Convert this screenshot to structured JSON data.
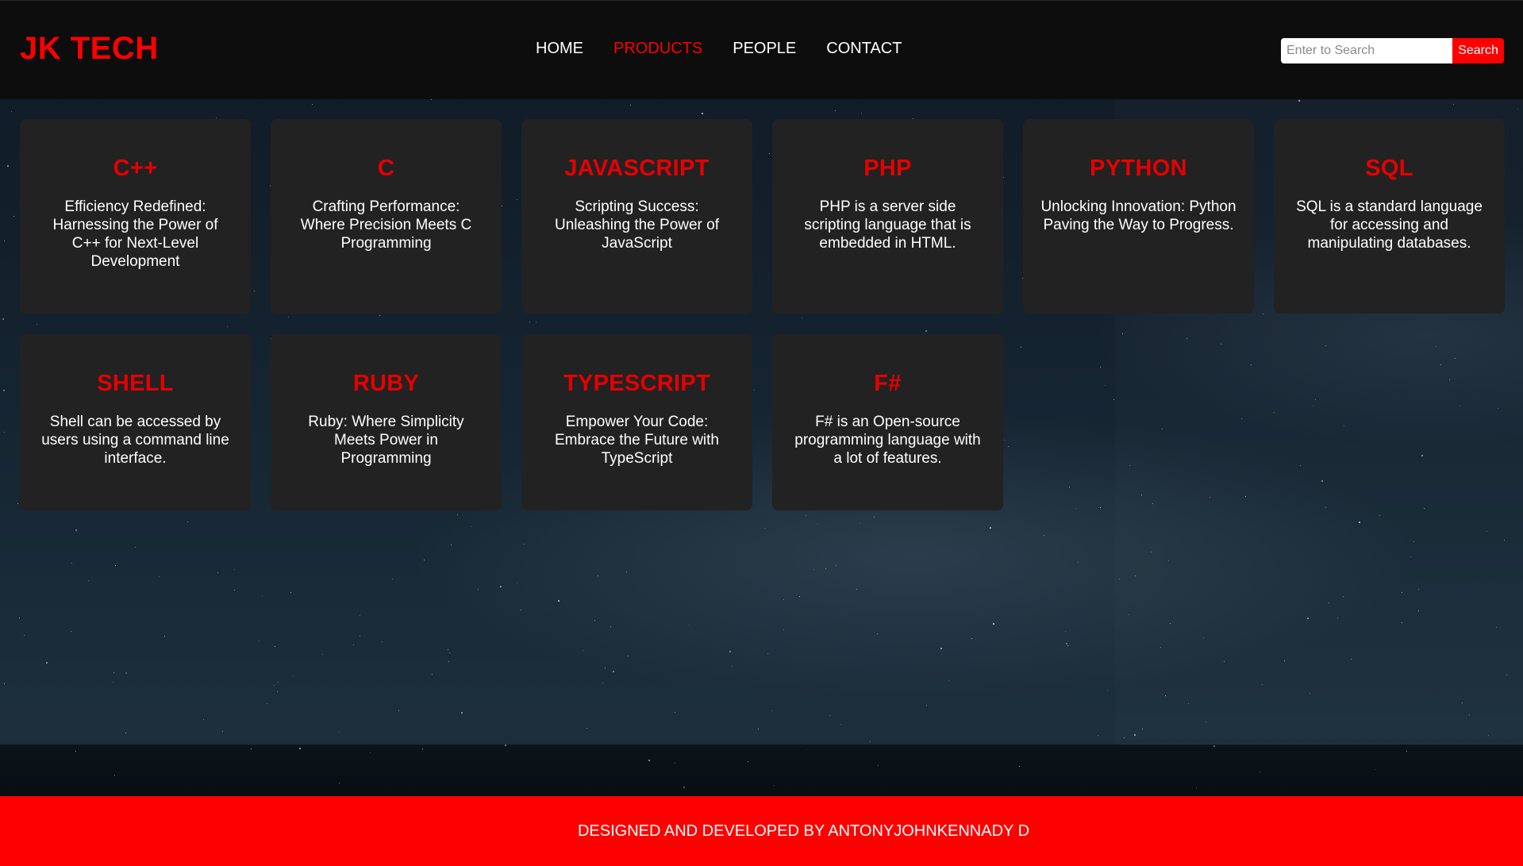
{
  "header": {
    "logo": "JK TECH",
    "nav": [
      {
        "label": "HOME",
        "active": false
      },
      {
        "label": "PRODUCTS",
        "active": true
      },
      {
        "label": "PEOPLE",
        "active": false
      },
      {
        "label": "CONTACT",
        "active": false
      }
    ],
    "search": {
      "placeholder": "Enter to Search",
      "value": "",
      "button_label": "Search"
    }
  },
  "products": [
    {
      "title": "C++",
      "description": "Efficiency Redefined: Harnessing the Power of C++ for Next-Level Development"
    },
    {
      "title": "C",
      "description": "Crafting Performance: Where Precision Meets C Programming"
    },
    {
      "title": "JAVASCRIPT",
      "description": "Scripting Success: Unleashing the Power of JavaScript"
    },
    {
      "title": "PHP",
      "description": "PHP is a server side scripting language that is embedded in HTML."
    },
    {
      "title": "PYTHON",
      "description": "Unlocking Innovation: Python Paving the Way to Progress."
    },
    {
      "title": "SQL",
      "description": "SQL is a standard language for accessing and manipulating databases."
    },
    {
      "title": "SHELL",
      "description": "Shell can be accessed by users using a command line interface."
    },
    {
      "title": "RUBY",
      "description": "Ruby: Where Simplicity Meets Power in Programming"
    },
    {
      "title": "TYPESCRIPT",
      "description": "Empower Your Code: Embrace the Future with TypeScript"
    },
    {
      "title": "F#",
      "description": "F# is an Open-source programming language with a lot of features."
    }
  ],
  "footer": {
    "text": "DESIGNED AND DEVELOPED BY ANTONYJOHNKENNADY D"
  },
  "colors": {
    "accent": "#ff0000",
    "header_bg": "#0d0d0d",
    "card_bg": "#222222"
  }
}
